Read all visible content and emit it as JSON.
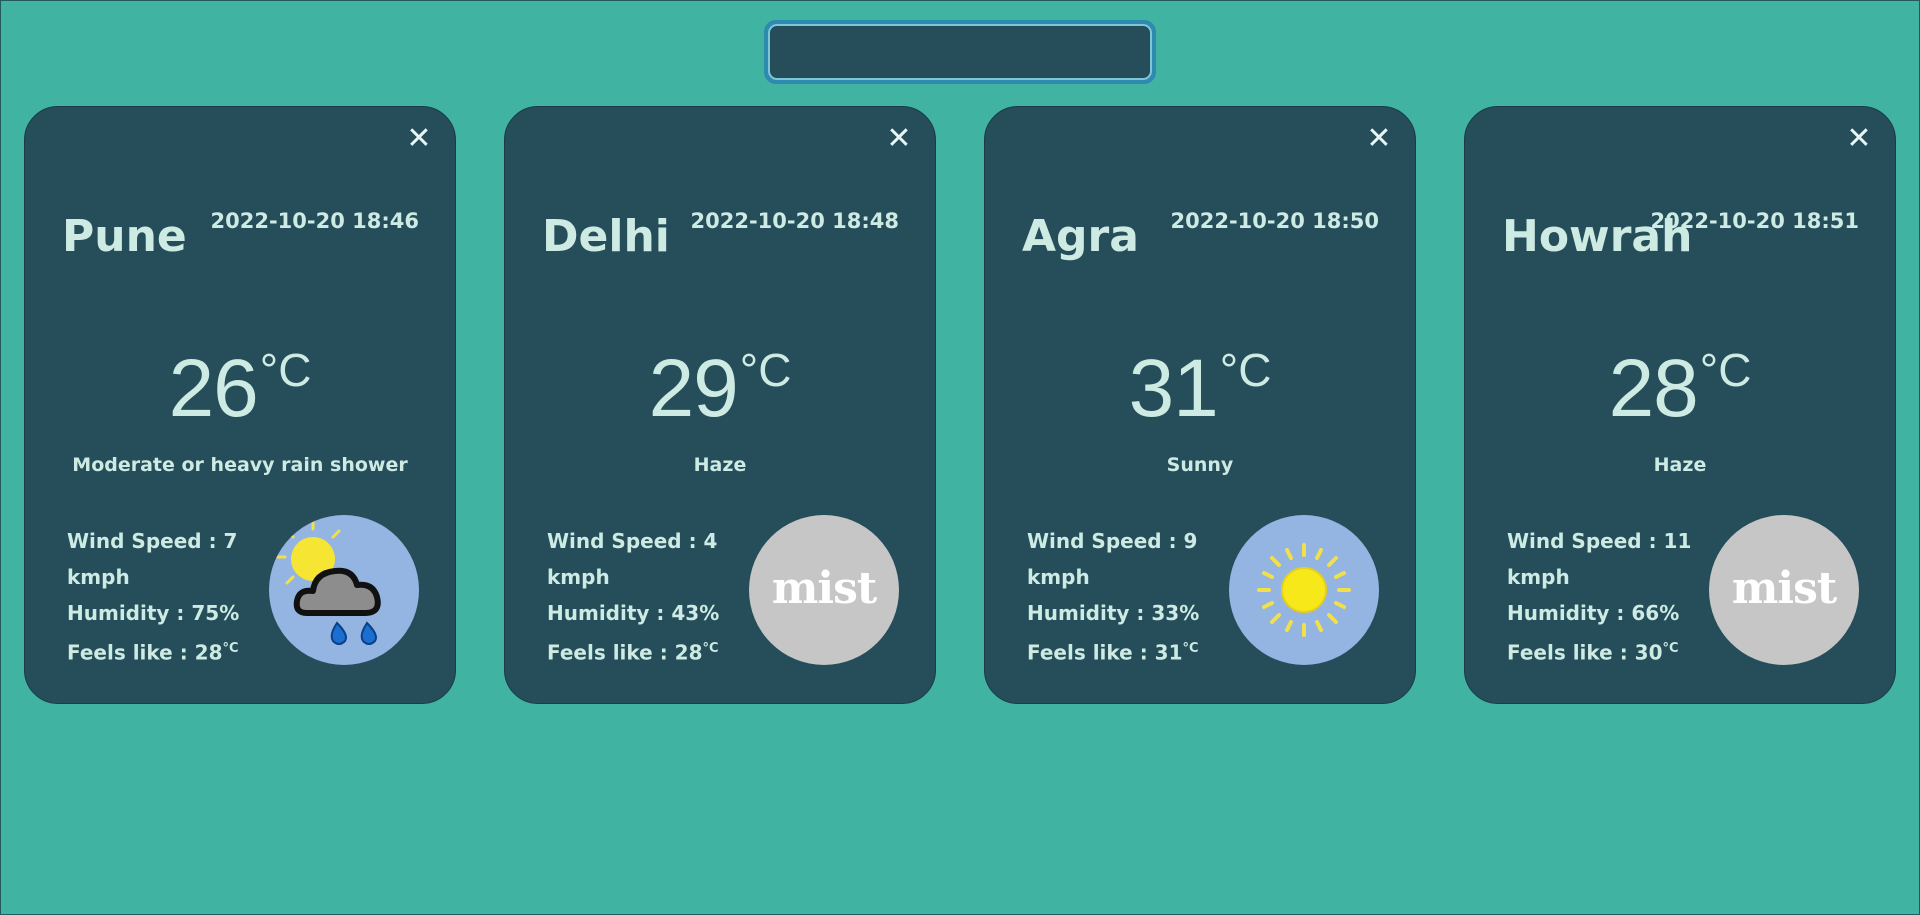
{
  "search": {
    "value": "",
    "placeholder": ""
  },
  "icons": {
    "close": "close-icon",
    "degree_unit": "°C"
  },
  "colors": {
    "background": "#41b3a3",
    "card": "#254d5a",
    "text": "#cdeae3",
    "icon_blue": "#94b4e2",
    "icon_grey": "#c6c6c6"
  },
  "cards": [
    {
      "city": "Pune",
      "datetime": "2022-10-20 18:46",
      "temp": "26",
      "unit": "°C",
      "condition": "Moderate or heavy rain shower",
      "wind_label": "Wind Speed : 7 kmph",
      "humidity_label": "Humidity : 75%",
      "feels_label": "Feels like : 28",
      "feels_unit": "°C",
      "icon": "rain-shower-icon",
      "icon_bg": "blue"
    },
    {
      "city": "Delhi",
      "datetime": "2022-10-20 18:48",
      "temp": "29",
      "unit": "°C",
      "condition": "Haze",
      "wind_label": "Wind Speed : 4 kmph",
      "humidity_label": "Humidity : 43%",
      "feels_label": "Feels like : 28",
      "feels_unit": "°C",
      "icon": "mist-icon",
      "icon_text": "mist",
      "icon_bg": "grey"
    },
    {
      "city": "Agra",
      "datetime": "2022-10-20 18:50",
      "temp": "31",
      "unit": "°C",
      "condition": "Sunny",
      "wind_label": "Wind Speed : 9 kmph",
      "humidity_label": "Humidity : 33%",
      "feels_label": "Feels like : 31",
      "feels_unit": "°C",
      "icon": "sun-icon",
      "icon_bg": "blue"
    },
    {
      "city": "Howrah",
      "datetime": "2022-10-20 18:51",
      "temp": "28",
      "unit": "°C",
      "condition": "Haze",
      "wind_label": "Wind Speed : 11 kmph",
      "humidity_label": "Humidity : 66%",
      "feels_label": "Feels like : 30",
      "feels_unit": "°C",
      "icon": "mist-icon",
      "icon_text": "mist",
      "icon_bg": "grey"
    }
  ]
}
